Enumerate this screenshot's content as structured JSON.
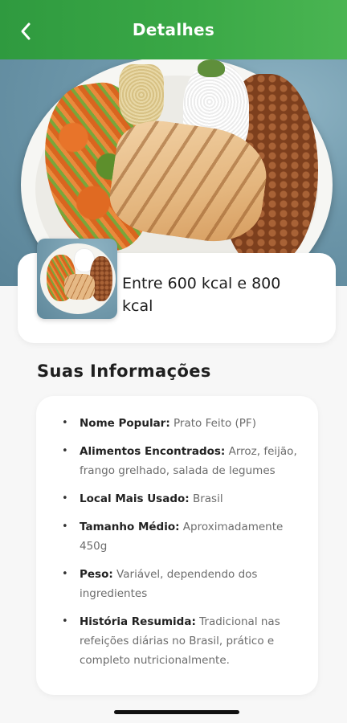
{
  "header": {
    "title": "Detalhes",
    "back_icon": "chevron-left-icon",
    "background_color": "#3aa846"
  },
  "hero": {
    "image_alt": "Prato com arroz, feijão, frango grelhado e salada"
  },
  "summary": {
    "kcal_text": "Entre 600 kcal e 800 kcal"
  },
  "info": {
    "title": "Suas Informações",
    "items": [
      {
        "label": "Nome Popular:",
        "value": " Prato Feito (PF)"
      },
      {
        "label": "Alimentos Encontrados:",
        "value": " Arroz, feijão, frango grelhado, salada de legumes"
      },
      {
        "label": "Local Mais Usado:",
        "value": " Brasil"
      },
      {
        "label": "Tamanho Médio:",
        "value": " Aproximadamente 450g"
      },
      {
        "label": "Peso:",
        "value": " Variável, dependendo dos ingredientes"
      },
      {
        "label": "História Resumida:",
        "value": " Tradicional nas refeições diárias no Brasil, prático e completo nutricionalmente."
      }
    ]
  }
}
